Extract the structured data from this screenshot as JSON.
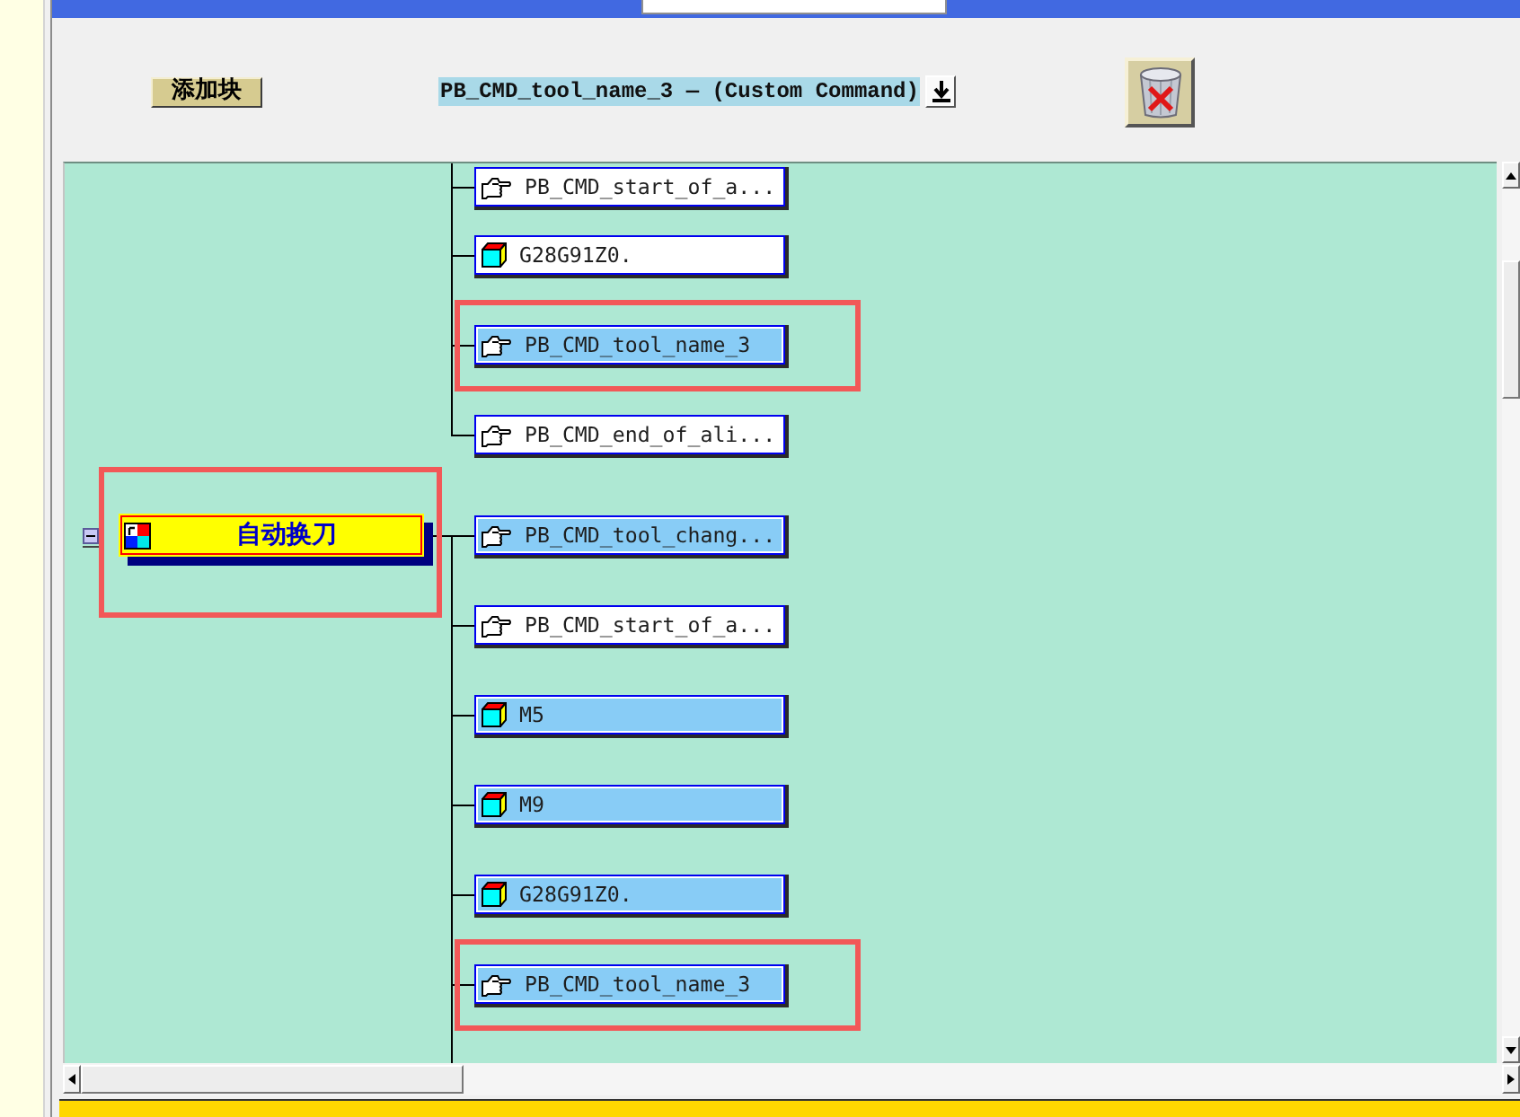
{
  "toolbar": {
    "add_block_button": "添加块",
    "block_selector": {
      "value": "PB_CMD_tool_name_3 — (Custom Command)"
    }
  },
  "canvas": {
    "upper_blocks": [
      {
        "label": "PB_CMD_start_of_a...",
        "kind": "command",
        "highlighted": false,
        "annotated": false
      },
      {
        "label": "G28G91Z0.",
        "kind": "block",
        "highlighted": false,
        "annotated": false
      },
      {
        "label": "PB_CMD_tool_name_3",
        "kind": "command",
        "highlighted": true,
        "annotated": true
      },
      {
        "label": "PB_CMD_end_of_ali...",
        "kind": "command",
        "highlighted": false,
        "annotated": false
      }
    ],
    "event": {
      "label": "自动换刀",
      "expanded": true,
      "annotated": true,
      "blocks": [
        {
          "label": "PB_CMD_tool_chang...",
          "kind": "command",
          "highlighted": true,
          "annotated": false
        },
        {
          "label": "PB_CMD_start_of_a...",
          "kind": "command",
          "highlighted": false,
          "annotated": false
        },
        {
          "label": "M5",
          "kind": "block",
          "highlighted": true,
          "annotated": false
        },
        {
          "label": "M9",
          "kind": "block",
          "highlighted": true,
          "annotated": false
        },
        {
          "label": "G28G91Z0.",
          "kind": "block",
          "highlighted": true,
          "annotated": false
        },
        {
          "label": "PB_CMD_tool_name_3",
          "kind": "command",
          "highlighted": true,
          "annotated": true
        }
      ]
    }
  }
}
